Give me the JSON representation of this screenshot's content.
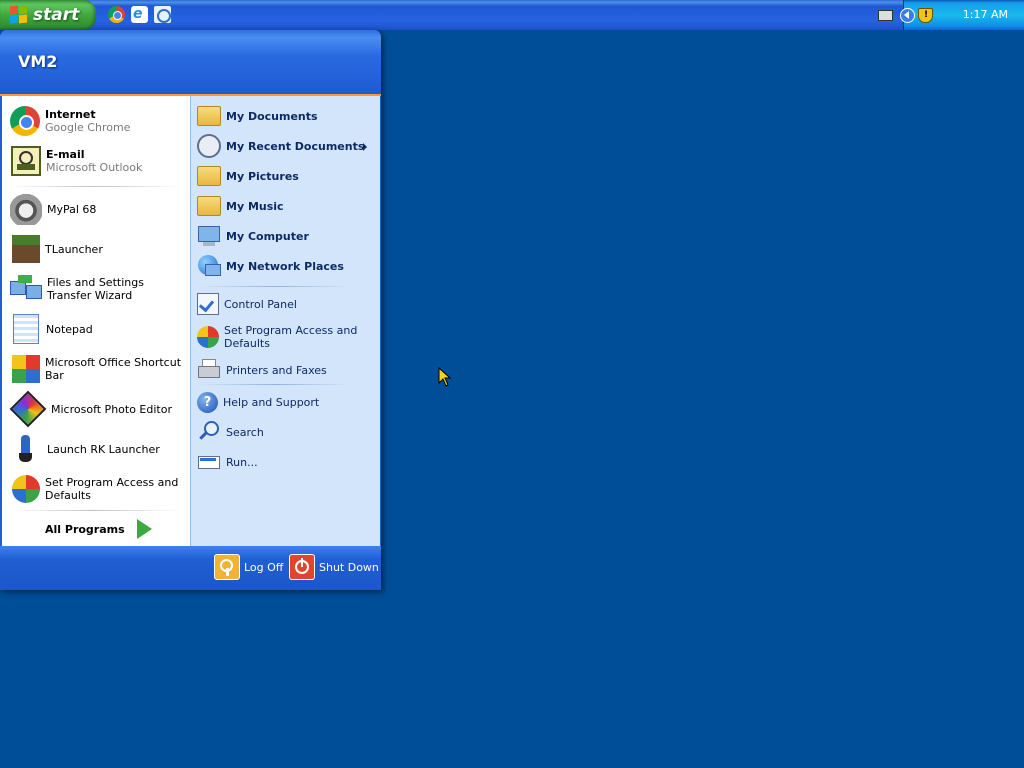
{
  "taskbar": {
    "start_label": "start",
    "quicklaunch": [
      "chrome-icon",
      "ie-icon",
      "outlook-express-icon"
    ],
    "tray": {
      "time": "1:17 AM",
      "icons": [
        "keyboard-icon",
        "show-hidden-icon",
        "security-shield-icon"
      ]
    }
  },
  "start_menu": {
    "user": "VM2",
    "pinned": [
      {
        "title": "Internet",
        "subtitle": "Google Chrome",
        "icon": "chrome-icon"
      },
      {
        "title": "E-mail",
        "subtitle": "Microsoft Outlook",
        "icon": "outlook-icon"
      }
    ],
    "recent": [
      {
        "label": "MyPal 68",
        "icon": "mypal-raccoon-icon"
      },
      {
        "label": "TLauncher",
        "icon": "tlauncher-block-icon"
      },
      {
        "label": "Files and Settings Transfer Wizard",
        "icon": "transfer-wizard-icon"
      },
      {
        "label": "Notepad",
        "icon": "notepad-icon"
      },
      {
        "label": "Microsoft Office Shortcut Bar",
        "icon": "office-shortcut-bar-icon"
      },
      {
        "label": "Microsoft Photo Editor",
        "icon": "photo-editor-icon"
      },
      {
        "label": "Launch RK Launcher",
        "icon": "rk-launcher-icon"
      },
      {
        "label": "Set Program Access and Defaults",
        "icon": "program-defaults-icon"
      }
    ],
    "all_programs": "All Programs",
    "places": [
      {
        "label": "My Documents",
        "icon": "folder-documents-icon"
      },
      {
        "label": "My Recent Documents",
        "icon": "recent-documents-icon",
        "submenu": true
      },
      {
        "label": "My Pictures",
        "icon": "folder-pictures-icon"
      },
      {
        "label": "My Music",
        "icon": "folder-music-icon"
      },
      {
        "label": "My Computer",
        "icon": "my-computer-icon"
      },
      {
        "label": "My Network Places",
        "icon": "network-places-icon"
      }
    ],
    "system": [
      {
        "label": "Control Panel",
        "icon": "control-panel-icon"
      },
      {
        "label": "Set Program Access and Defaults",
        "icon": "program-defaults-icon"
      },
      {
        "label": "Printers and Faxes",
        "icon": "printer-icon"
      }
    ],
    "help": [
      {
        "label": "Help and Support",
        "icon": "help-icon"
      },
      {
        "label": "Search",
        "icon": "search-icon"
      },
      {
        "label": "Run...",
        "icon": "run-icon"
      }
    ],
    "footer": {
      "logoff": "Log Off",
      "shutdown": "Shut Down"
    }
  },
  "colors": {
    "desktop": "#004e98",
    "taskbar": "#2663e0",
    "start_button": "#3fa83f",
    "menu_right_pane": "#d3e5fa",
    "accent_orange": "#ff9933"
  }
}
